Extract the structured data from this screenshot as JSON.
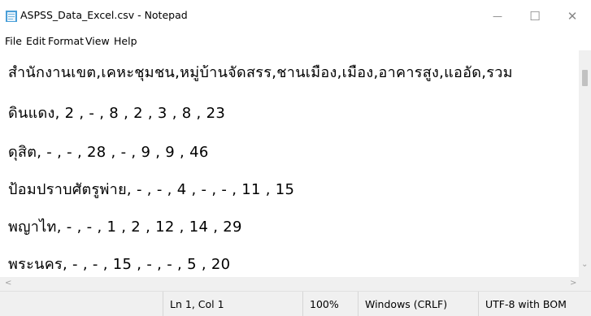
{
  "window": {
    "title": "ASPSS_Data_Excel.csv - Notepad",
    "minimize_glyph": "—",
    "maximize_glyph": "☐",
    "close_glyph": "✕"
  },
  "menu": [
    "File",
    "Edit",
    "Format",
    "View",
    "Help"
  ],
  "editor": {
    "lines": [
      "สำนักงานเขต,เคหะชุมชน,หมู่บ้านจัดสรร,ชานเมือง,เมือง,อาคารสูง,แออัด,รวม",
      "ดินแดง, 2 , - , 8 , 2 , 3 , 8 , 23",
      "ดุสิต, - , - , 28 , - , 9 , 9 , 46",
      "ป้อมปราบศัตรูพ่าย, - , - , 4 , - , - , 11 , 15",
      "พญาไท, - , - , 1 , 2 , 12 , 14 , 29",
      "พระนคร, - , - , 15 , - , - , 5 , 20"
    ]
  },
  "scrollbar": {
    "left_arrow": "<",
    "right_arrow": ">",
    "down_arrow": "⌄"
  },
  "status": {
    "position": "Ln 1, Col 1",
    "zoom": "100%",
    "line_ending": "Windows (CRLF)",
    "encoding": "UTF-8 with BOM"
  },
  "icons": {
    "app": "notepad-icon",
    "minimize": "minimize-icon",
    "maximize": "maximize-icon",
    "close": "close-icon"
  }
}
